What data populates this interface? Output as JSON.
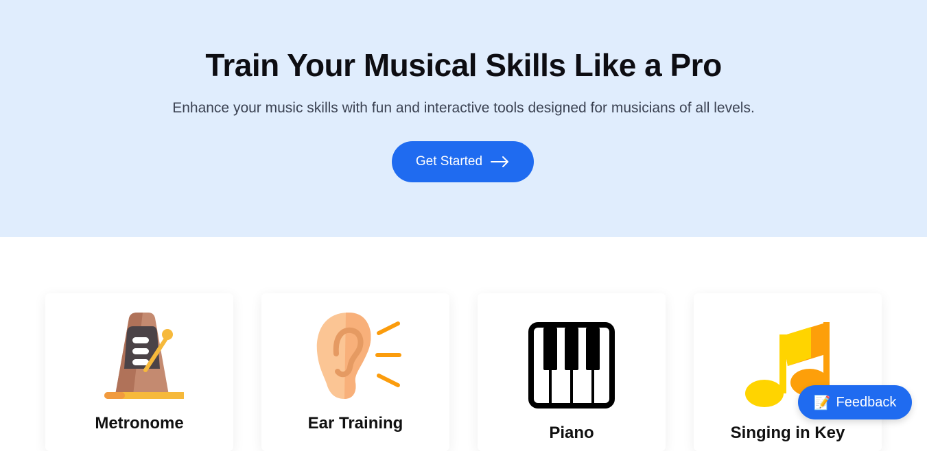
{
  "hero": {
    "title": "Train Your Musical Skills Like a Pro",
    "subtitle": "Enhance your music skills with fun and interactive tools designed for musicians of all levels.",
    "cta_label": "Get Started",
    "cta_icon": "arrow-right-icon",
    "background": "#e0edfd",
    "accent": "#1f6bf0"
  },
  "tools": [
    {
      "label": "Metronome",
      "icon": "metronome-icon"
    },
    {
      "label": "Ear Training",
      "icon": "ear-icon"
    },
    {
      "label": "Piano",
      "icon": "piano-keys-icon"
    },
    {
      "label": "Singing in Key",
      "icon": "music-note-icon"
    }
  ],
  "feedback": {
    "label": "Feedback",
    "icon": "📝"
  }
}
